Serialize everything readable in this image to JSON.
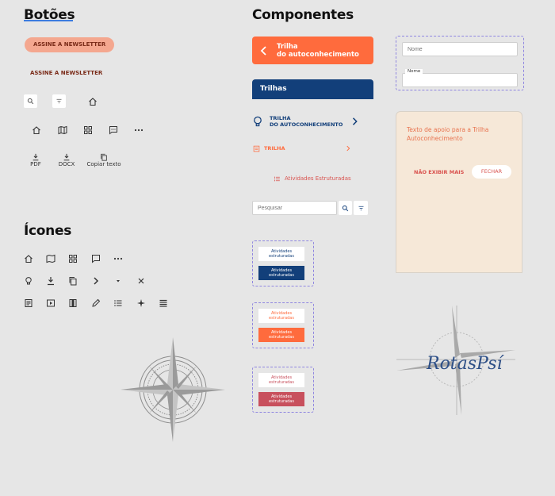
{
  "left": {
    "buttons_title": "Botões",
    "pill_label": "ASSINE A NEWSLETTER",
    "text_button_label": "ASSINE A NEWSLETTER",
    "downloads": [
      {
        "label": "PDF",
        "icon": "download-icon"
      },
      {
        "label": "DOCX",
        "icon": "download-icon"
      },
      {
        "label": "Copiar texto",
        "icon": "copy-icon"
      }
    ],
    "icons_title": "Ícones"
  },
  "middle": {
    "title": "Componentes",
    "trilha_header": "Trilha\ndo autoconhecimento",
    "trilhas_bar": "Trilhas",
    "trilha_item": "TRILHA\nDO AUTOCONHECIMENTO",
    "trilha_small": "TRILHA",
    "atividades_link": "Atividades Estruturadas",
    "search_placeholder": "Pesquisar",
    "card_label": "Atividades estruturadas"
  },
  "right": {
    "field1_placeholder": "Nome",
    "field2_label": "Nome",
    "tooltip_text": "Texto de apoio para a Trilha Autoconhecimento",
    "dismiss_label": "NÃO EXIBIR MAIS",
    "close_label": "FECHAR",
    "logo_text": "RotasPsí"
  },
  "colors": {
    "orange": "#ff6b3d",
    "navy": "#123f7a",
    "rose": "#c8505d",
    "peach": "#f6e8d8",
    "blue_underline": "#3d7de0"
  }
}
